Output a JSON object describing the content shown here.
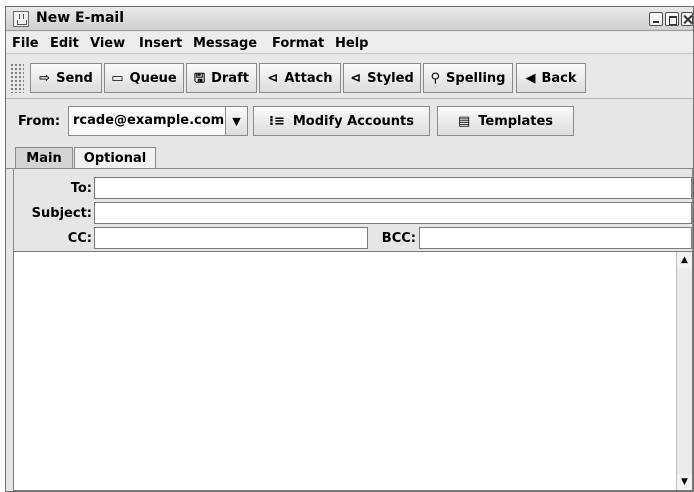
{
  "window": {
    "title": "New E-mail"
  },
  "menu": [
    "File",
    "Edit",
    "View",
    "Insert",
    "Message",
    "Format",
    "Help"
  ],
  "toolbar": {
    "buttons": [
      {
        "label": "Send",
        "icon": "send-icon",
        "glyph": "⇨"
      },
      {
        "label": "Queue",
        "icon": "queue-icon",
        "glyph": "▭"
      },
      {
        "label": "Draft",
        "icon": "draft-icon",
        "glyph": "🖫"
      },
      {
        "label": "Attach",
        "icon": "attach-icon",
        "glyph": "⊲"
      },
      {
        "label": "Styled",
        "icon": "styled-icon",
        "glyph": "⊲"
      },
      {
        "label": "Spelling",
        "icon": "spelling-icon",
        "glyph": "⚲"
      },
      {
        "label": "Back",
        "icon": "back-arrow-icon",
        "glyph": "◀"
      }
    ]
  },
  "from": {
    "label": "From:",
    "value": "rcade@example.com",
    "modify_accounts": "Modify Accounts",
    "templates": "Templates"
  },
  "tabs": [
    "Main",
    "Optional"
  ],
  "fields": {
    "to_label": "To:",
    "to_value": "",
    "subject_label": "Subject:",
    "subject_value": "",
    "cc_label": "CC:",
    "cc_value": "",
    "bcc_label": "BCC:",
    "bcc_value": ""
  },
  "body": {
    "text": ""
  },
  "colors": {
    "chrome": "#e6e6e6",
    "border": "#8a8a8a"
  }
}
